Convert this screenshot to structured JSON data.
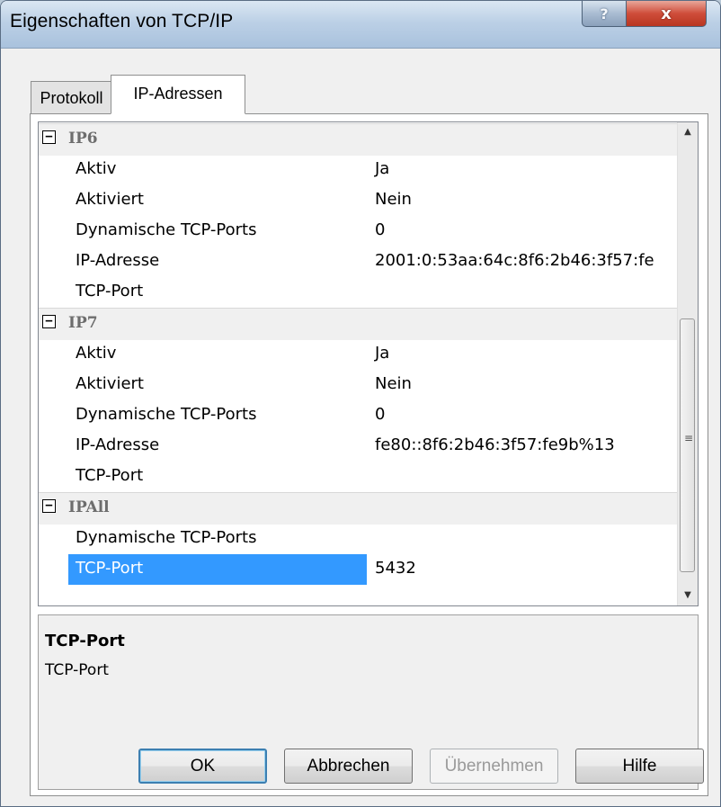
{
  "window": {
    "title": "Eigenschaften von TCP/IP",
    "help_button": "?",
    "close_button": "x"
  },
  "tabs": [
    {
      "label": "Protokoll",
      "active": false
    },
    {
      "label": "IP-Adressen",
      "active": true
    }
  ],
  "grid": {
    "categories": [
      {
        "name": "IP6",
        "toggle": "−",
        "rows": [
          {
            "key": "Aktiv",
            "value": "Ja"
          },
          {
            "key": "Aktiviert",
            "value": "Nein"
          },
          {
            "key": "Dynamische TCP-Ports",
            "value": "0"
          },
          {
            "key": "IP-Adresse",
            "value": "2001:0:53aa:64c:8f6:2b46:3f57:fe"
          },
          {
            "key": "TCP-Port",
            "value": ""
          }
        ]
      },
      {
        "name": "IP7",
        "toggle": "−",
        "rows": [
          {
            "key": "Aktiv",
            "value": "Ja"
          },
          {
            "key": "Aktiviert",
            "value": "Nein"
          },
          {
            "key": "Dynamische TCP-Ports",
            "value": "0"
          },
          {
            "key": "IP-Adresse",
            "value": "fe80::8f6:2b46:3f57:fe9b%13"
          },
          {
            "key": "TCP-Port",
            "value": ""
          }
        ]
      },
      {
        "name": "IPAll",
        "toggle": "−",
        "rows": [
          {
            "key": "Dynamische TCP-Ports",
            "value": ""
          },
          {
            "key": "TCP-Port",
            "value": "5432",
            "selected": true
          }
        ]
      }
    ],
    "scrollbar": {
      "up": "▲",
      "down": "▼",
      "grip": "≡"
    }
  },
  "description": {
    "title": "TCP-Port",
    "text": "TCP-Port"
  },
  "buttons": {
    "ok": "OK",
    "cancel": "Abbrechen",
    "apply": "Übernehmen",
    "help": "Hilfe"
  },
  "colors": {
    "selection": "#3399ff",
    "category_text": "#6d6d6d",
    "close_button": "#cf4d3a"
  }
}
